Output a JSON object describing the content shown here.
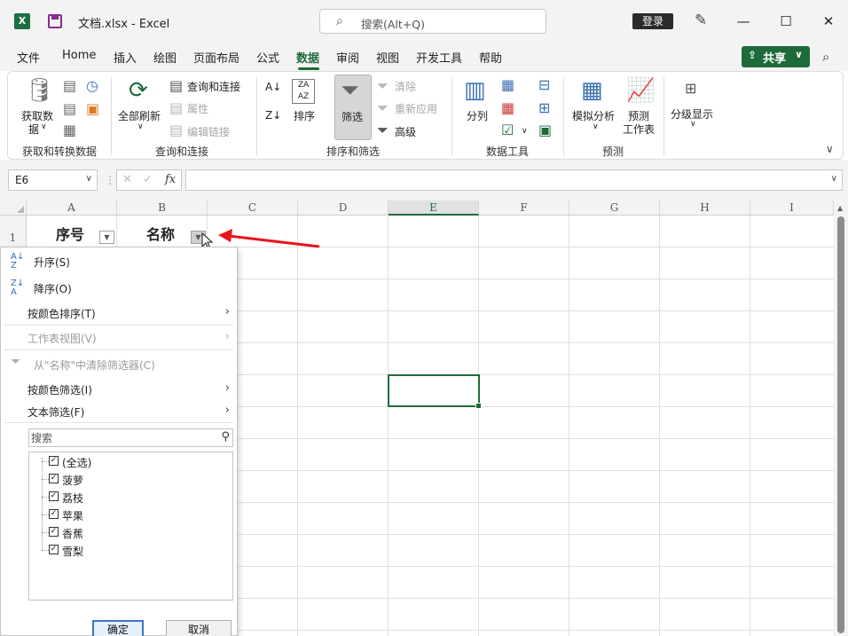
{
  "titlebar": {
    "logo": "X",
    "doc_title": "文档.xlsx  -  Excel",
    "search_placeholder": "搜索(Alt+Q)",
    "login": "登录",
    "icons": [
      "excel-logo-icon",
      "save-icon",
      "search-icon",
      "designer-brush-icon",
      "minimize-icon",
      "maximize-icon",
      "close-icon"
    ]
  },
  "menu": {
    "items": [
      "文件",
      "Home",
      "插入",
      "绘图",
      "页面布局",
      "公式",
      "数据",
      "审阅",
      "视图",
      "开发工具",
      "帮助"
    ],
    "active": "数据",
    "share": "共享"
  },
  "ribbon": {
    "get_data": "获取数",
    "get_data_2": "据",
    "group_get": "获取和转换数据",
    "refresh_all": "全部刷新",
    "queries": "查询和连接",
    "properties": "属性",
    "edit_links": "编辑链接",
    "group_queries": "查询和连接",
    "sort": "排序",
    "filter": "筛选",
    "clear": "清除",
    "reapply": "重新应用",
    "advanced": "高级",
    "group_sort": "排序和筛选",
    "split": "分列",
    "group_tools": "数据工具",
    "what_if": "模拟分析",
    "forecast_1": "预测",
    "forecast_2": "工作表",
    "group_forecast": "预测",
    "outline": "分级显示"
  },
  "formula_bar": {
    "name_box": "E6",
    "fx": "fx",
    "formula": ""
  },
  "grid": {
    "columns": [
      "A",
      "B",
      "C",
      "D",
      "E",
      "F",
      "G",
      "H",
      "I"
    ],
    "selected_column": "E",
    "row1_label": "1",
    "header_a": "序号",
    "header_b": "名称",
    "selected_cell": "E6"
  },
  "dropdown": {
    "sort_asc": "升序(S)",
    "sort_desc": "降序(O)",
    "sort_by_color": "按颜色排序(T)",
    "sheet_view": "工作表视图(V)",
    "clear_filter": "从\"名称\"中清除筛选器(C)",
    "filter_by_color": "按颜色筛选(I)",
    "text_filter": "文本筛选(F)",
    "search_placeholder": "搜索",
    "options": [
      {
        "label": "(全选)",
        "checked": true
      },
      {
        "label": "菠萝",
        "checked": true
      },
      {
        "label": "荔枝",
        "checked": true
      },
      {
        "label": "苹果",
        "checked": true
      },
      {
        "label": "香蕉",
        "checked": true
      },
      {
        "label": "雪梨",
        "checked": true
      }
    ],
    "ok": "确定",
    "cancel": "取消"
  },
  "colors": {
    "accent_green": "#1e6b3a",
    "annotation_red": "#e8141b"
  }
}
